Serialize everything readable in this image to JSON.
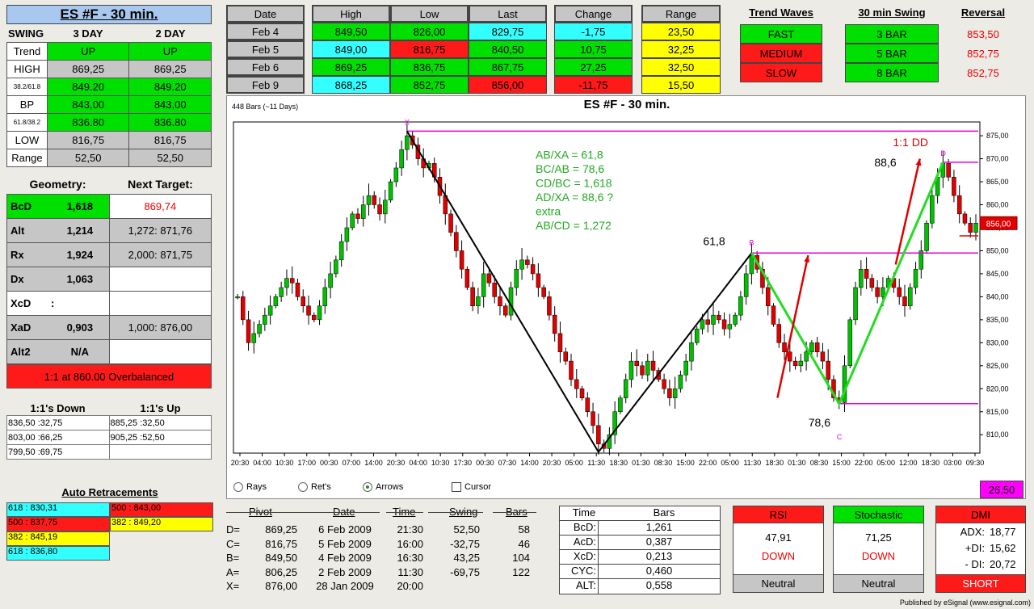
{
  "title": "ES #F - 30 min.",
  "swing": {
    "label": "SWING",
    "col1": "3 DAY",
    "col2": "2 DAY",
    "rows": [
      {
        "label": "Trend",
        "v1": "UP",
        "v2": "UP",
        "cls": "g",
        "small": false
      },
      {
        "label": "HIGH",
        "v1": "869,25",
        "v2": "869,25",
        "cls": "gr",
        "small": false
      },
      {
        "label": "38.2/61.8",
        "v1": "849.20",
        "v2": "849.20",
        "cls": "g",
        "small": true
      },
      {
        "label": "BP",
        "v1": "843,00",
        "v2": "843,00",
        "cls": "g",
        "small": false
      },
      {
        "label": "61.8/38.2",
        "v1": "836.80",
        "v2": "836.80",
        "cls": "g",
        "small": true
      },
      {
        "label": "LOW",
        "v1": "816,75",
        "v2": "816,75",
        "cls": "gr",
        "small": false
      },
      {
        "label": "Range",
        "v1": "52,50",
        "v2": "52,50",
        "cls": "gr",
        "small": false
      }
    ]
  },
  "geometry": {
    "label": "Geometry:",
    "next_label": "Next Target:",
    "rows": [
      {
        "name": "BcD",
        "val": "1,618",
        "target": "869,74"
      },
      {
        "name": "Alt",
        "val": "1,214",
        "target": "1,272: 871,76"
      },
      {
        "name": "Rx",
        "val": "1,924",
        "target": "2,000: 871,75"
      },
      {
        "name": "Dx",
        "val": "1,063",
        "target": ""
      },
      {
        "name": "XcD",
        "val": ":",
        "target": ""
      },
      {
        "name": "XaD",
        "val": "0,903",
        "target": "1,000: 876,00"
      },
      {
        "name": "Alt2",
        "val": "N/A",
        "target": ""
      }
    ],
    "overbalanced": "1:1 at 860.00 Overbalanced"
  },
  "ones": {
    "down_label": "1:1's Down",
    "up_label": "1:1's Up",
    "down": [
      "836,50 :32,75",
      "803,00 :66,25",
      "799,50 :69,75"
    ],
    "up": [
      "885,25 :32,50",
      "905,25 :52,50",
      ""
    ]
  },
  "auto_retr": {
    "label": "Auto Retracements",
    "left": [
      {
        "t": "618 : 830,31",
        "c": "#33ffff"
      },
      {
        "t": "500 : 837,75",
        "c": "#ff1a1a"
      },
      {
        "t": "382 : 845,19",
        "c": "#ffff00"
      },
      {
        "t": "618 : 836,80",
        "c": "#33ffff"
      }
    ],
    "right": [
      {
        "t": "500 : 843,00",
        "c": "#ff1a1a"
      },
      {
        "t": "382 : 849,20",
        "c": "#ffff00"
      }
    ]
  },
  "daily": {
    "headers": [
      "Date",
      "High",
      "Low",
      "Last",
      "Change",
      "Range"
    ],
    "rows": [
      {
        "date": "Feb  4",
        "high": "849,50",
        "low": "826,00",
        "last": "829,75",
        "change": "-1,75",
        "range": "23,50",
        "hc": "g",
        "lc": "g",
        "lac": "cy",
        "cc": "cy"
      },
      {
        "date": "Feb  5",
        "high": "849,00",
        "low": "816,75",
        "last": "840,50",
        "change": "10,75",
        "range": "32,25",
        "hc": "cy",
        "lc": "r",
        "lac": "g",
        "cc": "g"
      },
      {
        "date": "Feb  6",
        "high": "869,25",
        "low": "836,75",
        "last": "867,75",
        "change": "27,25",
        "range": "32,50",
        "hc": "g",
        "lc": "g",
        "lac": "g",
        "cc": "g"
      },
      {
        "date": "Feb  9",
        "high": "868,25",
        "low": "852,75",
        "last": "856,00",
        "change": "-11,75",
        "range": "15,50",
        "hc": "cy",
        "lc": "g",
        "lac": "r",
        "cc": "r"
      }
    ]
  },
  "trend_waves": {
    "label": "Trend Waves",
    "items": [
      {
        "t": "FAST",
        "c": "#00e000"
      },
      {
        "t": "MEDIUM",
        "c": "#ff1a1a"
      },
      {
        "t": "SLOW",
        "c": "#ff1a1a"
      }
    ]
  },
  "swing30": {
    "label": "30 min Swing",
    "items": [
      "3 BAR",
      "5 BAR",
      "8 BAR"
    ]
  },
  "reversal": {
    "label": "Reversal",
    "items": [
      "853,50",
      "852,75",
      "852,75"
    ]
  },
  "chart": {
    "bars_label": "448 Bars (~11 Days)",
    "title": "ES #F - 30 min.",
    "ratios": [
      "AB/XA = 61,8",
      "BC/AB = 78,6",
      "CD/BC = 1,618",
      "AD/XA = 88,6 ?",
      "extra",
      "AB/CD = 1,272"
    ],
    "label_618": "61,8",
    "label_786": "78,6",
    "label_886": "88,6",
    "label_dd": "1:1 DD",
    "pt_x": "X",
    "pt_b": "B",
    "pt_c": "C",
    "pt_d": "D",
    "price_tag": "856,00",
    "box_value": "26,50",
    "controls": [
      "Rays",
      "Ret's",
      "Arrows",
      "Cursor"
    ]
  },
  "chart_data": {
    "type": "candlestick",
    "title": "ES #F - 30 min.",
    "ylim": [
      806,
      878
    ],
    "yticks": [
      810,
      815,
      820,
      825,
      830,
      835,
      840,
      845,
      850,
      855,
      860,
      865,
      870,
      875
    ],
    "xticks": [
      "20:30",
      "04:00",
      "10:30",
      "17:00",
      "00:30",
      "07:00",
      "14:00",
      "20:30",
      "04:00",
      "10:30",
      "17:30",
      "00:30",
      "07:30",
      "14:00",
      "20:30",
      "05:00",
      "11:30",
      "18:30",
      "01:30",
      "08:30",
      "15:00",
      "22:00",
      "05:00",
      "11:30",
      "18:30",
      "01:30",
      "08:30",
      "15:00",
      "22:00",
      "05:00",
      "12:00",
      "18:30",
      "03:00",
      "09:30"
    ],
    "pattern_points": {
      "X": 876.0,
      "A": 806.25,
      "B": 849.5,
      "C": 816.75,
      "D": 869.25
    },
    "levels": [
      876.0,
      869.25,
      849.5,
      853.25,
      816.75
    ],
    "close_path": [
      840,
      835,
      830,
      832,
      834,
      836,
      838,
      840,
      842,
      844,
      843,
      840,
      838,
      836,
      835,
      838,
      842,
      845,
      848,
      852,
      855,
      858,
      857,
      860,
      862,
      860,
      858,
      861,
      865,
      868,
      872,
      875,
      873,
      870,
      868,
      869,
      866,
      862,
      858,
      854,
      850,
      846,
      842,
      838,
      840,
      845,
      843,
      840,
      838,
      836,
      842,
      846,
      848,
      847,
      845,
      842,
      840,
      836,
      832,
      828,
      826,
      822,
      820,
      818,
      815,
      812,
      808,
      807,
      810,
      815,
      818,
      822,
      826,
      825,
      823,
      826,
      824,
      822,
      820,
      818,
      820,
      823,
      826,
      830,
      833,
      835,
      834,
      836,
      835,
      833,
      834,
      836,
      840,
      845,
      849,
      846,
      842,
      838,
      834,
      830,
      828,
      826,
      825,
      826,
      828,
      830,
      828,
      826,
      822,
      818,
      817,
      825,
      835,
      842,
      846,
      844,
      842,
      840,
      842,
      844,
      842,
      840,
      838,
      842,
      846,
      850,
      856,
      862,
      866,
      869,
      866,
      862,
      858,
      856,
      854,
      856
    ]
  },
  "pivot": {
    "headers": [
      "Pivot",
      "Date",
      "Time",
      "Swing",
      "Bars"
    ],
    "rows": [
      {
        "k": "D=",
        "p": "869,25",
        "d": "6  Feb  2009",
        "t": "21:30",
        "s": "52,50",
        "b": "58"
      },
      {
        "k": "C=",
        "p": "816,75",
        "d": "5  Feb  2009",
        "t": "16:00",
        "s": "-32,75",
        "b": "46"
      },
      {
        "k": "B=",
        "p": "849,50",
        "d": "4  Feb  2009",
        "t": "16:30",
        "s": "43,25",
        "b": "104"
      },
      {
        "k": "A=",
        "p": "806,25",
        "d": "2  Feb  2009",
        "t": "11:30",
        "s": "-69,75",
        "b": "122"
      },
      {
        "k": "X=",
        "p": "876,00",
        "d": "28  Jan  2009",
        "t": "20:00",
        "s": "",
        "b": ""
      }
    ]
  },
  "timebars": {
    "headers": [
      "Time",
      "Bars"
    ],
    "rows": [
      {
        "k": "BcD:",
        "v": "1,261"
      },
      {
        "k": "AcD:",
        "v": "0,387"
      },
      {
        "k": "XcD:",
        "v": "0,213"
      },
      {
        "k": "CYC:",
        "v": "0,460"
      },
      {
        "k": "ALT:",
        "v": "0,558"
      }
    ]
  },
  "rsi": {
    "label": "RSI",
    "value": "47,91",
    "dir": "DOWN",
    "status": "Neutral"
  },
  "stoch": {
    "label": "Stochastic",
    "value": "71,25",
    "dir": "DOWN",
    "status": "Neutral"
  },
  "dmi": {
    "label": "DMI",
    "adx_l": "ADX:",
    "adx": "18,77",
    "pdi_l": "+DI:",
    "pdi": "15,62",
    "mdi_l": "- DI:",
    "mdi": "20,72",
    "status": "SHORT"
  },
  "footer": "Published by eSignal (www.esignal.com)"
}
